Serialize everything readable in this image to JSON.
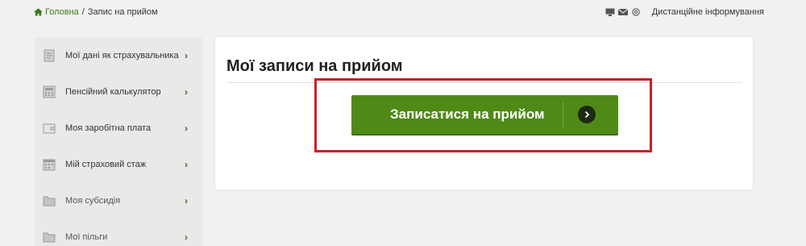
{
  "breadcrumb": {
    "home": "Головна",
    "separator": "/",
    "current": "Запис на прийом"
  },
  "topbar": {
    "icons": [
      "monitor-icon",
      "envelope-icon",
      "at-icon"
    ],
    "remote_info": "Дистанційне інформування"
  },
  "sidebar": {
    "items": [
      {
        "label": "Мої дані як страхувальника",
        "icon": "document-icon"
      },
      {
        "label": "Пенсійний калькулятор",
        "icon": "calculator-icon"
      },
      {
        "label": "Моя заробітна плата",
        "icon": "wallet-icon"
      },
      {
        "label": "Мій страховий стаж",
        "icon": "calendar-icon"
      },
      {
        "label": "Моя субсидія",
        "icon": "folder-icon"
      },
      {
        "label": "Мої пільги",
        "icon": "folder-icon"
      }
    ],
    "chevron": "›"
  },
  "main": {
    "title": "Мої записи на прийом",
    "cta_label": "Записатися на прийом",
    "cta_arrow": "›"
  },
  "colors": {
    "brand_green": "#4f8a16",
    "highlight_red": "#c8202a",
    "link_green": "#3c7a1c"
  }
}
